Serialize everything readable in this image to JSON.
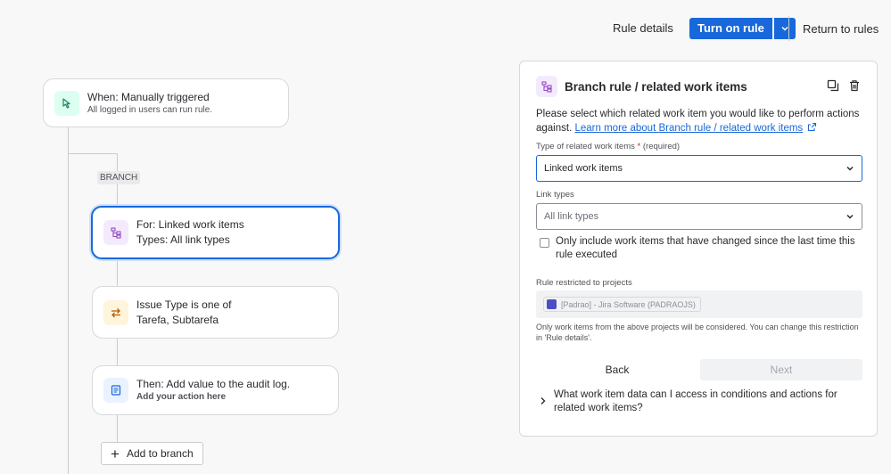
{
  "topbar": {
    "rule_details": "Rule details",
    "turn_on_rule": "Turn on rule",
    "return_to_rules": "Return to rules"
  },
  "flow": {
    "trigger": {
      "title": "When: Manually triggered",
      "subtitle": "All logged in users can run rule."
    },
    "branch_tag": "BRANCH",
    "branch_node": {
      "line1": "For: Linked work items",
      "line2": "Types: All link types"
    },
    "condition_node": {
      "line1": "Issue Type is one of",
      "line2": "Tarefa, Subtarefa"
    },
    "action_node": {
      "title": "Then: Add value to the audit log.",
      "subtitle": "Add your action here"
    },
    "add_to_branch": "Add to branch"
  },
  "panel": {
    "title": "Branch rule / related work items",
    "description": "Please select which related work item you would like to perform actions against.",
    "learn_more": "Learn more about Branch rule / related work items",
    "type_label": "Type of related work items",
    "type_required_star": "*",
    "type_required_text": "(required)",
    "type_value": "Linked work items",
    "link_types_label": "Link types",
    "link_types_placeholder": "All link types",
    "checkbox_label": "Only include work items that have changed since the last time this rule executed",
    "restricted_label": "Rule restricted to projects",
    "project_chip": "[Padrao] - Jira Software (PADRAOJS)",
    "helper_text": "Only work items from the above projects will be considered. You can change this restriction in 'Rule details'.",
    "back": "Back",
    "next": "Next",
    "faq": "What work item data can I access in conditions and actions for related work items?"
  },
  "colors": {
    "primary": "#1868db",
    "trigger_icon_bg": "#dcfff1",
    "branch_icon_bg": "#f3ebfd",
    "condition_icon_bg": "#fff5db",
    "action_icon_bg": "#e9f2fe"
  }
}
